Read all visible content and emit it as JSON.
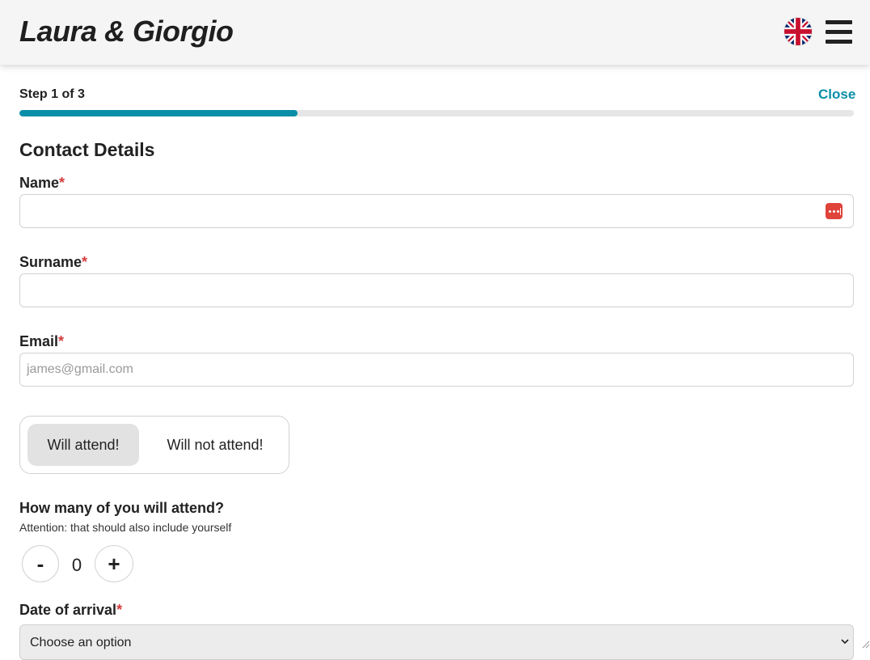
{
  "header": {
    "brand": "Laura & Giorgio",
    "language_icon": "uk-flag-icon",
    "menu_icon": "hamburger-menu-icon"
  },
  "wizard": {
    "step_label": "Step 1 of 3",
    "close_label": "Close",
    "progress_fraction": 0.3333,
    "accent_color": "#0b8ea8"
  },
  "form": {
    "section_title": "Contact Details",
    "required_marker": "*",
    "name": {
      "label": "Name",
      "value": "",
      "placeholder": "",
      "icon": "password-manager-icon"
    },
    "surname": {
      "label": "Surname",
      "value": "",
      "placeholder": ""
    },
    "email": {
      "label": "Email",
      "value": "",
      "placeholder": "james@gmail.com"
    },
    "attendance": {
      "options": [
        "Will attend!",
        "Will not attend!"
      ],
      "selected": "Will attend!"
    },
    "guests": {
      "question": "How many of you will attend?",
      "hint": "Attention: that should also include yourself",
      "decrement_label": "-",
      "increment_label": "+",
      "count": "0"
    },
    "arrival": {
      "label": "Date of arrival",
      "selected": "Choose an option"
    }
  }
}
